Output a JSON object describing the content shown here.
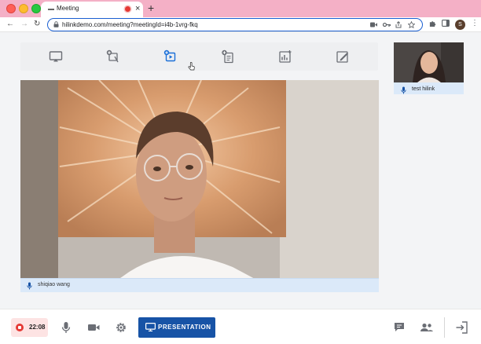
{
  "browser": {
    "tab_title": "Meeting",
    "tab_close_glyph": "×",
    "new_tab_glyph": "+",
    "url": "hilinkdemo.com/meeting?meetingId=i4b-1vrg-fkq",
    "profile_initial": "S",
    "nav": {
      "back": "←",
      "forward": "→",
      "reload": "↻"
    }
  },
  "toolbar_icons": [
    "screen-share-icon",
    "add-whiteboard-icon",
    "add-video-icon",
    "add-document-icon",
    "add-chart-icon",
    "annotate-icon"
  ],
  "active_tool": "add-video-icon",
  "participants": {
    "main": {
      "name": "shiqiao wang",
      "mic_icon": "mic-icon"
    },
    "self": {
      "name": "test hilink",
      "mic_icon": "mic-icon"
    }
  },
  "controls": {
    "record_time": "22:08",
    "presentation_label": "PRESENTATION",
    "icons": [
      "record-icon",
      "mic-icon",
      "camera-icon",
      "settings-icon",
      "chat-icon",
      "participants-icon",
      "leave-icon"
    ]
  },
  "colors": {
    "accent": "#1753a6",
    "record": "#e53935",
    "name_strip": "#dbe9f9",
    "tab_strip": "#f4b0c6"
  }
}
